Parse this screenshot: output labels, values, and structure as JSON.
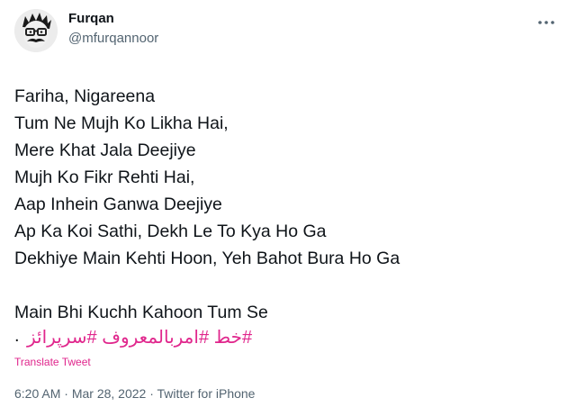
{
  "author": {
    "name": "Furqan",
    "handle": "@mfurqannoor"
  },
  "tweet": {
    "text": "Fariha, Nigareena\nTum Ne Mujh Ko Likha Hai,\nMere Khat Jala Deejiye\nMujh Ko Fikr Rehti Hai,\nAap Inhein Ganwa Deejiye\nAp Ka Koi Sathi, Dekh Le To Kya Ho Ga\nDekhiye Main Kehti Hoon, Yeh Bahot Bura Ho Ga\n\nMain Bhi Kuchh Kahoon Tum Se",
    "hashtags": [
      "#خط",
      "#امربالمعروف",
      "#سرپرائز"
    ],
    "trailing_dot": "."
  },
  "translate_label": "Translate Tweet",
  "meta": {
    "time": "6:20 AM",
    "date": "Mar 28, 2022",
    "source": "Twitter for iPhone",
    "separator": " · "
  },
  "colors": {
    "accent": "#e0268c",
    "secondary_text": "#536471",
    "primary_text": "#0f1419"
  },
  "icons": {
    "more": "more-horizontal-icon",
    "avatar": "cartoon-face-avatar"
  }
}
